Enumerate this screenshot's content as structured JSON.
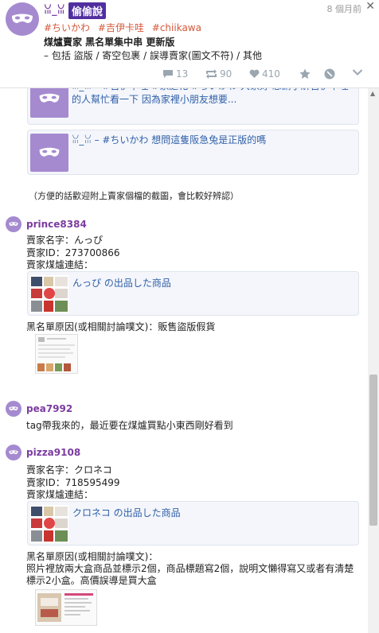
{
  "post": {
    "author": "ꈍ_ꈍ",
    "badge": "偷偷說",
    "time": "8 個月前",
    "close_icon": "close-icon",
    "tags": [
      "#ちいかわ",
      "#吉伊卡哇",
      "#chiikawa"
    ],
    "title": "煤爐賣家 黑名單集中串 更新版",
    "subtitle": "– 包括 盜版 / 寄空包裹 / 誤導賣家(圖文不符) / 其他",
    "actions": {
      "comments": "13",
      "reposts": "90",
      "likes": "410"
    }
  },
  "quotes": [
    {
      "text": "ꈍ_ꈍ – #吉伊卡哇 #家庭化 #ちいかわ 大家好 想請了解吉伊卡哇的人幫忙看一下 因為家裡小朋友想要..."
    },
    {
      "text": "ꈍ_ꈍ – #ちいかわ 想問這隻阪急兔是正版的嗎"
    }
  ],
  "note": "（方便的話歡迎附上賣家個檔的截圖，會比較好辨認）",
  "comments": [
    {
      "user": "prince8384",
      "lines": [
        "賣家名字：んっぴ",
        "賣家ID：273700866",
        "賣家煤爐連結："
      ],
      "shop_link": "んっぴ の出品した商品",
      "reason": "黑名單原因(或相關討論噗文)：販售盜版假貨"
    },
    {
      "user": "pea7992",
      "lines": [
        "tag帶我來的，最近要在煤爐買點小東西剛好看到"
      ]
    },
    {
      "user": "pizza9108",
      "lines": [
        "賣家名字：クロネコ",
        "賣家ID：718595499",
        "賣家煤爐連結："
      ],
      "shop_link": "クロネコ の出品した商品",
      "reason": "黑名單原因(或相關討論噗文)：",
      "reason_detail": [
        "照片裡放兩大盒商品並標示2個，商品標題寫2個，說明文懶得寫又或者有清楚",
        "標示2小盒。高價誤導是買大盒"
      ]
    }
  ]
}
